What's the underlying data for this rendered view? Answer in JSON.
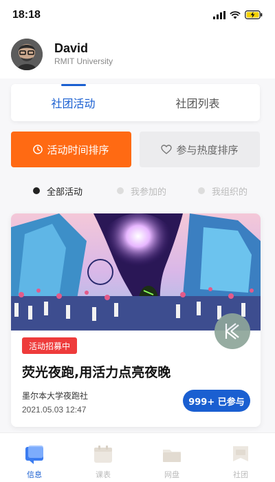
{
  "status_bar": {
    "time": "18:18"
  },
  "profile": {
    "name": "David",
    "organization": "RMIT University"
  },
  "tabs": [
    {
      "label": "社团活动",
      "active": true
    },
    {
      "label": "社团列表",
      "active": false
    }
  ],
  "sort_buttons": [
    {
      "label": "活动时间排序",
      "icon": "clock-icon",
      "active": true
    },
    {
      "label": "参与热度排序",
      "icon": "heart-icon",
      "active": false
    }
  ],
  "filters": [
    {
      "label": "全部活动",
      "active": true
    },
    {
      "label": "我参加的",
      "active": false
    },
    {
      "label": "我组织的",
      "active": false
    }
  ],
  "event": {
    "badge": "活动招募中",
    "title": "荧光夜跑,用活力点亮夜晚",
    "organizer": "墨尔本大学夜跑社",
    "datetime": "2021.05.03 12:47",
    "joined": "999+ 已参与"
  },
  "bottom_nav": [
    {
      "label": "信息",
      "icon": "message-icon",
      "active": true
    },
    {
      "label": "课表",
      "icon": "calendar-icon",
      "active": false
    },
    {
      "label": "网盘",
      "icon": "folder-icon",
      "active": false
    },
    {
      "label": "社团",
      "icon": "club-flag-icon",
      "active": false
    }
  ],
  "colors": {
    "accent_blue": "#1a5fd1",
    "accent_orange": "#ff6a13",
    "badge_red": "#ee3b3b"
  }
}
